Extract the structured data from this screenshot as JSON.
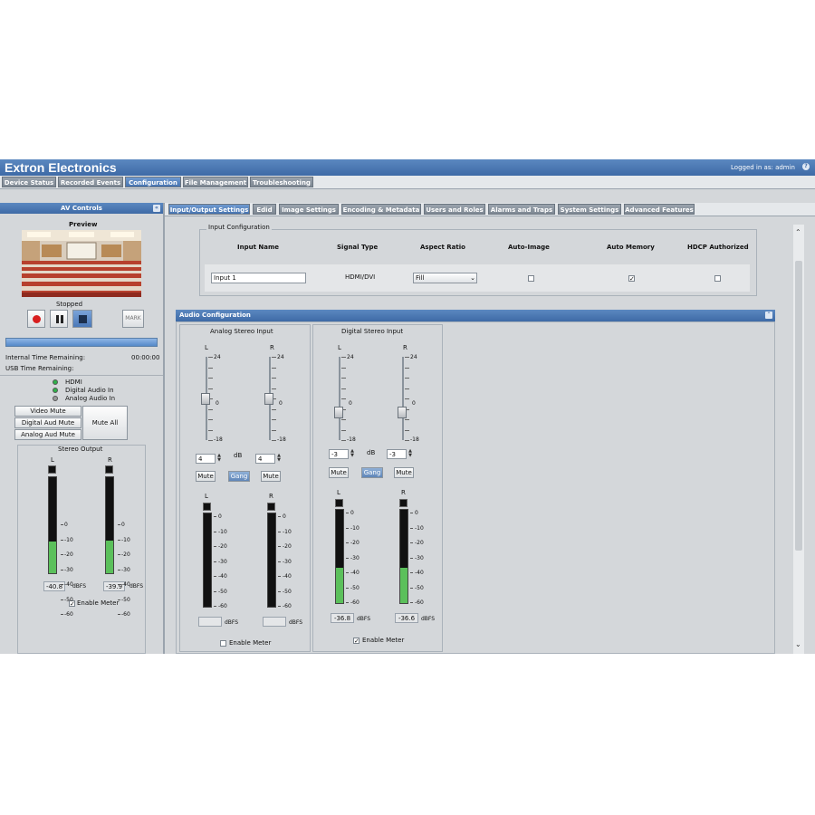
{
  "app": {
    "title": "Extron Electronics",
    "login": "Logged in as: admin",
    "help_icon": "?"
  },
  "main_tabs": [
    {
      "label": "Device Status"
    },
    {
      "label": "Recorded Events"
    },
    {
      "label": "Configuration",
      "active": true
    },
    {
      "label": "File Management"
    },
    {
      "label": "Troubleshooting"
    }
  ],
  "av_controls": {
    "header": "AV Controls",
    "collapse_icon": "«",
    "preview_label": "Preview",
    "status": "Stopped",
    "mark_label": "MARK",
    "internal_time_label": "Internal Time Remaining:",
    "internal_time_value": "00:00:00",
    "usb_time_label": "USB Time Remaining:",
    "signals": [
      {
        "label": "HDMI",
        "color": "#2fb14a"
      },
      {
        "label": "Digital Audio In",
        "color": "#2fb14a"
      },
      {
        "label": "Analog Audio In",
        "color": "#9a9a9a"
      }
    ],
    "mute_buttons": [
      "Video Mute",
      "Digital Aud Mute",
      "Analog Aud Mute"
    ],
    "mute_all": "Mute All",
    "stereo_output": {
      "title": "Stereo Output",
      "left_label": "L",
      "right_label": "R",
      "scale": [
        "0",
        "-10",
        "-20",
        "-30",
        "-40",
        "-50",
        "-60"
      ],
      "left_level_fraction": 0.33,
      "right_level_fraction": 0.34,
      "left_value": "-40.8",
      "right_value": "-39.9",
      "unit": "dBFS",
      "enable_meter": "Enable Meter",
      "enable_meter_checked": "✓"
    }
  },
  "sub_tabs": [
    {
      "label": "Input/Output Settings",
      "active": true
    },
    {
      "label": "Edid"
    },
    {
      "label": "Image Settings"
    },
    {
      "label": "Encoding & Metadata"
    },
    {
      "label": "Users and Roles"
    },
    {
      "label": "Alarms and Traps"
    },
    {
      "label": "System Settings"
    },
    {
      "label": "Advanced Features"
    }
  ],
  "input_config": {
    "title": "Input Configuration",
    "headers": [
      "Input Name",
      "Signal Type",
      "Aspect Ratio",
      "Auto-Image",
      "Auto Memory",
      "HDCP Authorized"
    ],
    "input_name": "Input 1",
    "signal_type": "HDMI/DVI",
    "aspect_ratio": "Fill",
    "auto_image": "",
    "auto_memory": "✓",
    "hdcp": ""
  },
  "audio_config": {
    "header": "Audio Configuration",
    "collapse_icon": "⌃",
    "analog": {
      "title": "Analog Stereo Input",
      "left_label": "L",
      "right_label": "R",
      "fader_top": "24",
      "fader_mid": "0",
      "fader_bottom": "-18",
      "left_gain": "4",
      "right_gain": "4",
      "db_label": "dB",
      "mute_label": "Mute",
      "gang_label": "Gang",
      "scale": [
        "0",
        "-10",
        "-20",
        "-30",
        "-40",
        "-50",
        "-60"
      ],
      "left_value": "",
      "right_value": "",
      "left_level_fraction": 0,
      "right_level_fraction": 0,
      "unit": "dBFS",
      "enable_meter": "Enable Meter",
      "enable_meter_checked": ""
    },
    "digital": {
      "title": "Digital Stereo Input",
      "left_label": "L",
      "right_label": "R",
      "fader_top": "24",
      "fader_mid": "0",
      "fader_bottom": "-18",
      "left_gain": "-3",
      "right_gain": "-3",
      "db_label": "dB",
      "mute_label": "Mute",
      "gang_label": "Gang",
      "scale": [
        "0",
        "-10",
        "-20",
        "-30",
        "-40",
        "-50",
        "-60"
      ],
      "left_value": "-36.8",
      "right_value": "-36.6",
      "left_level_fraction": 0.38,
      "right_level_fraction": 0.38,
      "unit": "dBFS",
      "enable_meter": "Enable Meter",
      "enable_meter_checked": "✓"
    }
  },
  "colors": {
    "header_blue": "#3e6aa6",
    "meter_green": "#5bc05b",
    "record_red": "#d81f1f",
    "stop_blue": "#4a78b8"
  }
}
